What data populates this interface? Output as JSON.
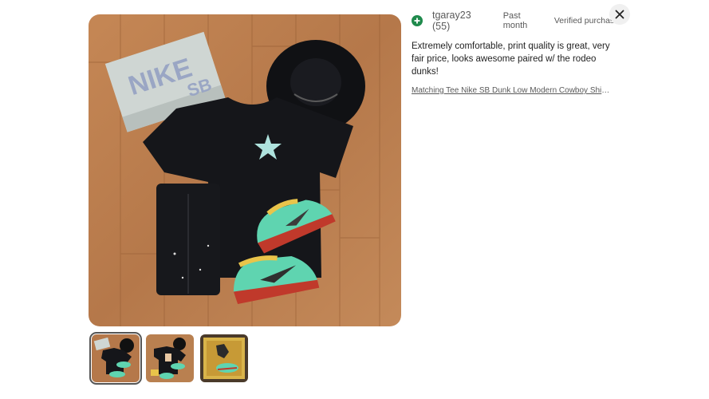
{
  "review": {
    "reviewer_name": "tgaray23 (55)",
    "time_label": "Past month",
    "verified_label": "Verified purchase",
    "text": "Extremely comfortable, print quality is great, very fair price, looks awesome paired w/ the rodeo dunks!",
    "item_link": "Matching Tee Nike SB Dunk Low Modern Cowboy Shirt..."
  },
  "main_image": {
    "box_text_top": "NIKE",
    "box_text_bottom": "SB"
  },
  "thumbnails": [
    {
      "name": "outfit-photo-1",
      "selected": true
    },
    {
      "name": "outfit-photo-2",
      "selected": false
    },
    {
      "name": "cowboy-shirt-photo",
      "selected": false
    }
  ],
  "icons": {
    "plus": "plus-icon",
    "close": "close-icon"
  },
  "colors": {
    "badge_green": "#1f8a4c",
    "floor_wood": "#b5784a",
    "shirt_black": "#15161a",
    "sneaker_teal": "#5fd4b0"
  }
}
